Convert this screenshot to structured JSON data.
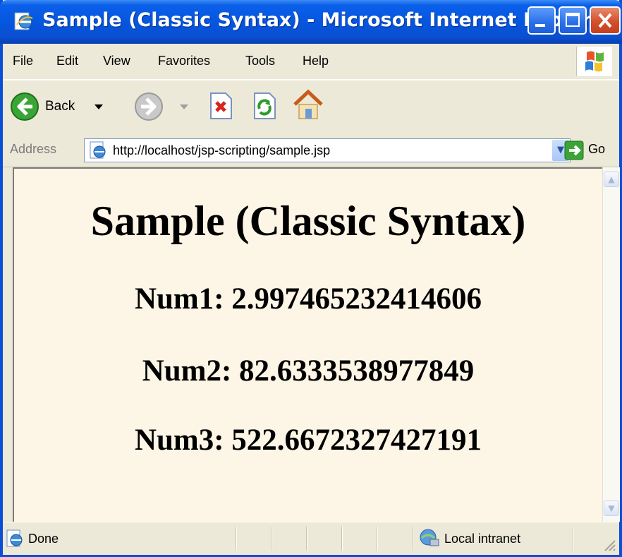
{
  "window": {
    "title": "Sample (Classic Syntax) - Microsoft Internet Explorer"
  },
  "menu": [
    "File",
    "Edit",
    "View",
    "Favorites",
    "Tools",
    "Help"
  ],
  "toolbar": {
    "back_label": "Back",
    "icons": [
      "back-icon",
      "forward-icon",
      "stop-icon",
      "refresh-icon",
      "home-icon"
    ]
  },
  "address": {
    "label": "Address",
    "url": "http://localhost/jsp-scripting/sample.jsp",
    "go_label": "Go"
  },
  "page": {
    "title": "Sample (Classic Syntax)",
    "lines": [
      "Num1: 2.997465232414606",
      "Num2: 82.6333538977849",
      "Num3: 522.6672327427191"
    ]
  },
  "status": {
    "text": "Done",
    "zone": "Local intranet"
  },
  "colors": {
    "titlebar": "#0655de",
    "content_bg": "#fdf5e6",
    "chrome": "#ece9d8"
  }
}
